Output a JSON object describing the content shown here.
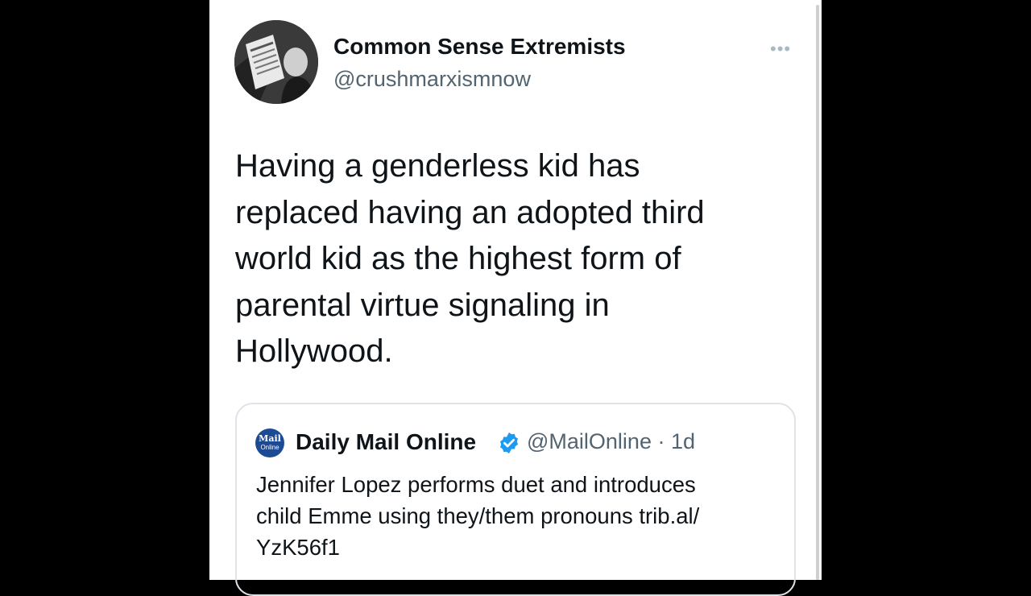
{
  "tweet": {
    "author": {
      "display_name": "Common Sense Extremists",
      "handle": "@crushmarxismnow"
    },
    "more_icon": "more-horizontal-icon",
    "text_lines": [
      "Having a genderless kid has",
      "replaced having an adopted third",
      "world kid as the highest form of",
      "parental virtue signaling in",
      "Hollywood."
    ]
  },
  "quoted_tweet": {
    "logo_text_top": "Mail",
    "logo_text_bottom": "Online",
    "display_name": "Daily Mail Online",
    "handle_time": "@MailOnline · 1d",
    "verified_icon": "verified-badge-icon",
    "text_lines": [
      "Jennifer Lopez performs duet and introduces",
      "child Emme using they/them pronouns trib.al/",
      "YzK56f1"
    ]
  },
  "colors": {
    "text_primary": "#0f1419",
    "text_secondary": "#536471",
    "verified_blue": "#1d9bf0",
    "border": "#dfe3e8",
    "mail_blue": "#1d4a94"
  }
}
